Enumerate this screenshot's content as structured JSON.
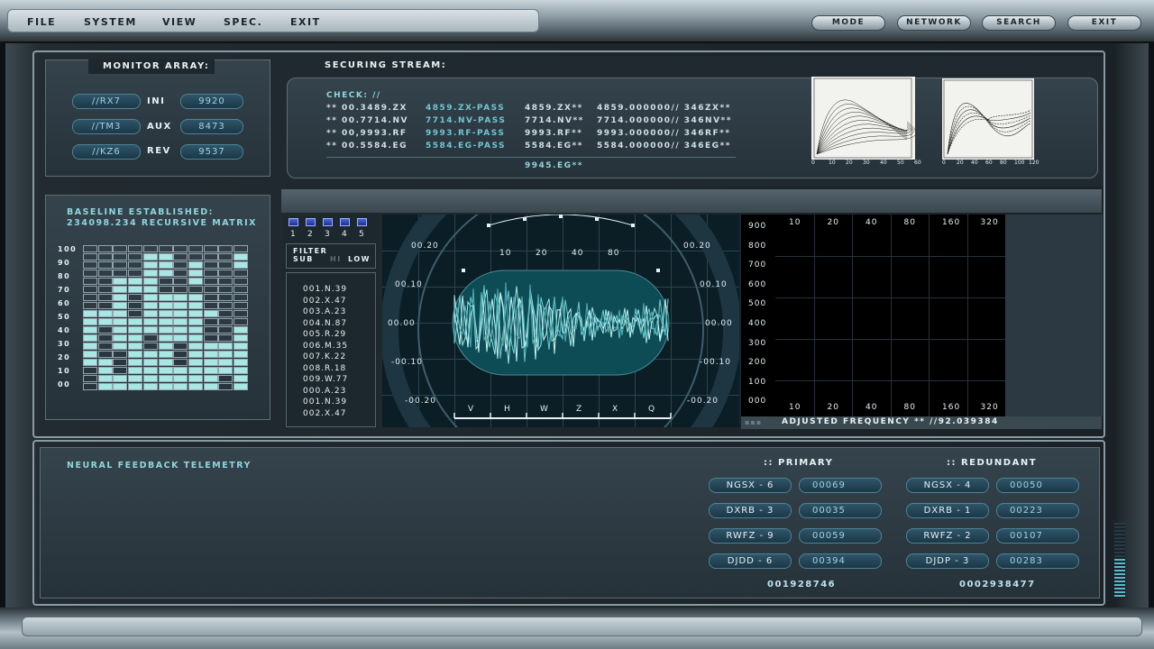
{
  "menu": {
    "items": [
      "FILE",
      "SYSTEM",
      "VIEW",
      "SPEC.",
      "EXIT"
    ]
  },
  "topbuttons": [
    "MODE",
    "NETWORK",
    "SEARCH",
    "EXIT"
  ],
  "monitor": {
    "title": "MONITOR ARRAY:",
    "rows": [
      {
        "id": "//RX7",
        "key": "INI",
        "value": "9920"
      },
      {
        "id": "//TM3",
        "key": "AUX",
        "value": "8473"
      },
      {
        "id": "//KZ6",
        "key": "REV",
        "value": "9537"
      }
    ]
  },
  "stream": {
    "title": "SECURING STREAM:",
    "check_label": "CHECK: //",
    "rows": [
      [
        "** 00.3489.ZX",
        "4859.ZX-PASS",
        "4859.ZX**",
        "4859.000000// 346ZX**"
      ],
      [
        "** 00.7714.NV",
        "7714.NV-PASS",
        "7714.NV**",
        "7714.000000// 346NV**"
      ],
      [
        "** 00,9993.RF",
        "9993.RF-PASS",
        "9993.RF**",
        "9993.000000// 346RF**"
      ],
      [
        "** 00.5584.EG",
        "5584.EG-PASS",
        "5584.EG**",
        "5584.000000// 346EG**"
      ]
    ],
    "footer": "9945.EG**",
    "thumb1_xticks": [
      "0",
      "10",
      "20",
      "30",
      "40",
      "50",
      "60"
    ],
    "thumb2_xticks": [
      "0",
      "20",
      "40",
      "60",
      "80",
      "100",
      "120"
    ]
  },
  "baseline": {
    "line1": "BASELINE ESTABLISHED:",
    "line2": "234098.234 RECURSIVE MATRIX",
    "yticks": [
      "100",
      "90",
      "80",
      "70",
      "60",
      "50",
      "40",
      "30",
      "20",
      "10",
      "00"
    ]
  },
  "filter": {
    "channels": [
      "1",
      "2",
      "3",
      "4",
      "5"
    ],
    "label": "FILTER",
    "sub": "SUB",
    "hi": "HI",
    "low": "LOW",
    "list": [
      "001.N.39",
      "002.X.47",
      "003.A.23",
      "004.N.87",
      "005.R.29",
      "006.M.35",
      "007.K.22",
      "008.R.18",
      "009.W.77",
      "000.A.23",
      "001.N.39",
      "002.X.47"
    ]
  },
  "scope": {
    "top_scale": [
      "10",
      "20",
      "40",
      "80"
    ],
    "bottom_scale": [
      "V",
      "H",
      "W",
      "Z",
      "X",
      "Q"
    ],
    "left_scale": [
      "00.20",
      "00.10",
      "00.00",
      "-00.10",
      "-00.20"
    ],
    "right_scale": [
      "00.20",
      "00.10",
      "00.00",
      "-00.10",
      "-00.20"
    ]
  },
  "freq": {
    "yticks": [
      "900",
      "800",
      "700",
      "600",
      "500",
      "400",
      "300",
      "200",
      "100",
      "000"
    ],
    "xticks_top": [
      "10",
      "20",
      "40",
      "80",
      "160",
      "320"
    ],
    "xticks_bottom": [
      "10",
      "20",
      "40",
      "80",
      "160",
      "320"
    ],
    "caption": "ADJUSTED FREQUENCY ** //92.039384"
  },
  "telemetry": {
    "title": "NEURAL FEEDBACK TELEMETRY",
    "primary": {
      "title": ":: PRIMARY",
      "rows": [
        [
          "NGSX - 6",
          "00069"
        ],
        [
          "DXRB - 3",
          "00035"
        ],
        [
          "RWFZ - 9",
          "00059"
        ],
        [
          "DJDD - 6",
          "00394"
        ]
      ],
      "total": "001928746"
    },
    "redundant": {
      "title": ":: REDUNDANT",
      "rows": [
        [
          "NGSX - 4",
          "00050"
        ],
        [
          "DXRB - 1",
          "00223"
        ],
        [
          "RWFZ - 2",
          "00107"
        ],
        [
          "DJDP - 3",
          "00283"
        ]
      ],
      "total": "0002938477"
    }
  },
  "colors": {
    "accent": "#8fd6df",
    "panel": "#2c3942",
    "pill": "#1f4051",
    "cell_on": "#a8e7e4"
  }
}
